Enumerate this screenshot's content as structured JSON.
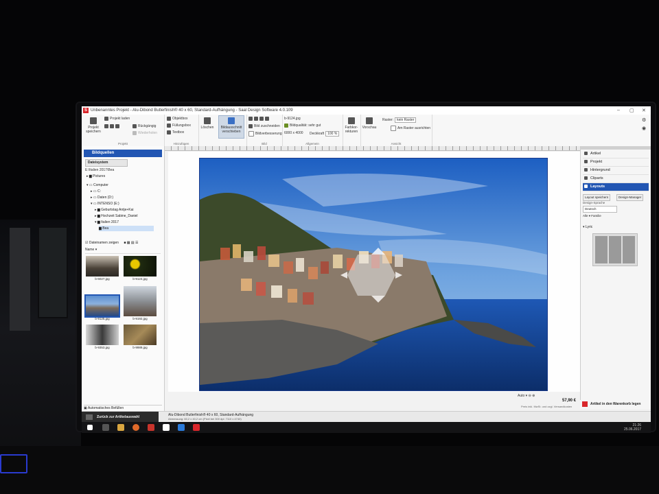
{
  "window": {
    "title": "Unbenanntes Projekt - Alu-Dibond Butlerfinish® 40 x 60, Standard-Aufhängung - Saal Design Software 4.0.109",
    "logo_letter": "S"
  },
  "ribbon": {
    "projekt_group": "Projekt",
    "projekt_speichern": "Projekt speichern",
    "projekt_laden": "Projekt laden",
    "rueckgaengig": "Rückgängig",
    "wiederholen": "Wiederholen",
    "hinzufuegen_group": "Hinzufügen",
    "objektbox": "Objektbox",
    "fuellungsbox": "Füllungsbox",
    "textbox": "Textbox",
    "loeschen": "Löschen",
    "bildausschnitt": "Bildausschnitt verschieben",
    "bild_group": "Bild",
    "bild_zuschneiden": "Bild zuschneiden",
    "bildverbesserung": "Bildverbesserung",
    "allgemein_group": "Allgemein",
    "filename": "b-9124.jpg",
    "bildqualitaet": "Bildqualität: sehr gut",
    "resolution": "6000 x 4000",
    "deckkraft_label": "Deckkraft",
    "deckkraft_value": "100 %",
    "farbkorrekturen": "Farbkor- rekturen",
    "vorschau": "Vorschau",
    "ansicht_group": "Ansicht",
    "raster_label": "Raster:",
    "raster_value": "kein Raster",
    "am_raster": "Am Raster ausrichten"
  },
  "left_panel": {
    "title": "Bildquellen",
    "tab": "Dateisystem",
    "path": "E:\\Italien 2017\\Bea",
    "tree": [
      "Pictures",
      "Computer",
      "C:",
      "Daten (D:)",
      "INTENSO (E:)",
      "Geburtstag Antje+Kai",
      "Hochzeit Sabine_Daniel",
      "Italien 2017",
      "Bea"
    ],
    "show_names": "Dateinamen zeigen",
    "sort": "Name",
    "thumbnails": [
      "b-6027.jpg",
      "b-9124.jpg",
      "b-9125.jpg",
      "b-9192.jpg",
      "b-9353.jpg",
      "b-9989.jpg"
    ],
    "autofill": "Automatisches Befüllen"
  },
  "right_panel": {
    "items": [
      "Artikel",
      "Projekt",
      "Hintergrund",
      "Cliparts",
      "Layouts"
    ],
    "layout_speichern": "Layout speichern",
    "design_manager": "Design-Manager",
    "design_sprache_label": "Design-Sprache",
    "design_sprache_value": "Deutsch",
    "filter": "Alle ▾ Familie",
    "lyric": "Lyric"
  },
  "canvas": {
    "zoom": "Auto",
    "price": "57,90 €",
    "price_note": "Preis inkl. MwSt. und zzgl. Versandkosten",
    "cart": "Artikel in den Warenkorb legen"
  },
  "status": {
    "back": "Zurück zur Artikelauswahl",
    "product": "Alu-Dibond Butlerfinish® 40 x 60, Standard-Aufhängung",
    "dims": "Abmessung: 60,2 x 40,2 cm (Pixel bei 300 dpi: 7110 x 4740)"
  },
  "taskbar": {
    "time": "21:26",
    "date": "25.06.2017"
  },
  "colors": {
    "accent": "#2256b3",
    "brand_red": "#d9262b"
  }
}
